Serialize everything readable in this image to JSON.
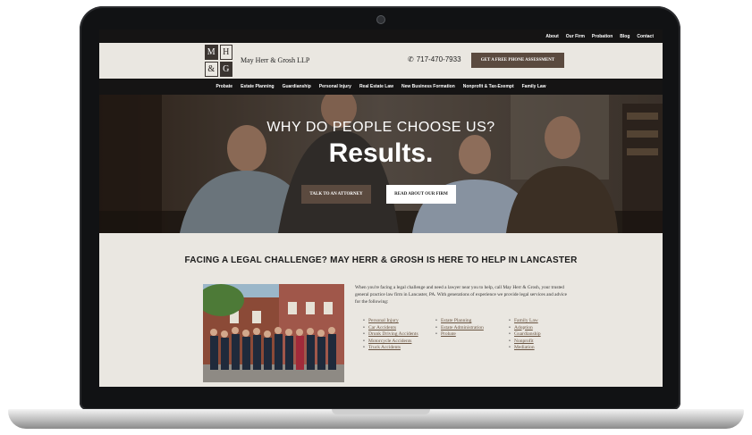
{
  "topnav": [
    "About",
    "Our Firm",
    "Probation",
    "Blog",
    "Contact"
  ],
  "header": {
    "logo_letters": [
      "M",
      "H",
      "&",
      "G"
    ],
    "firm_name": "May Herr & Grosh LLP",
    "phone": "717-470-7933",
    "cta_label": "GET A FREE PHONE ASSESSMENT"
  },
  "mainnav": [
    "Probate",
    "Estate Planning",
    "Guardianship",
    "Personal Injury",
    "Real Estate Law",
    "New Business Formation",
    "Nonprofit & Tax-Exempt",
    "Family Law"
  ],
  "hero": {
    "subtitle": "WHY DO PEOPLE CHOOSE US?",
    "title": "Results.",
    "btn_talk": "TALK TO AN ATTORNEY",
    "btn_read": "READ ABOUT OUR FIRM"
  },
  "content": {
    "heading": "FACING A LEGAL CHALLENGE? MAY HERR & GROSH IS HERE TO HELP IN LANCASTER",
    "intro": "When you're facing a legal challenge and need a lawyer near you to help, call May Herr & Grosh, your trusted general practice law firm in Lancaster, PA. With generations of experience we provide legal services and advice for the following:",
    "list1": [
      "Personal Injury",
      "Car Accidents",
      "Drunk Driving Accidents",
      "Motorcycle Accidents",
      "Truck Accidents"
    ],
    "list2": [
      "Estate Planning",
      "Estate Administration",
      "Probate"
    ],
    "list3": [
      "Family Law",
      "Adoption",
      "Guardianship",
      "Nonprofit",
      "Mediation"
    ]
  },
  "colors": {
    "brand_brown": "#5b4a3f",
    "nav_dark": "#151414",
    "page_bg": "#eae7e1",
    "link_brown": "#6a5542"
  }
}
